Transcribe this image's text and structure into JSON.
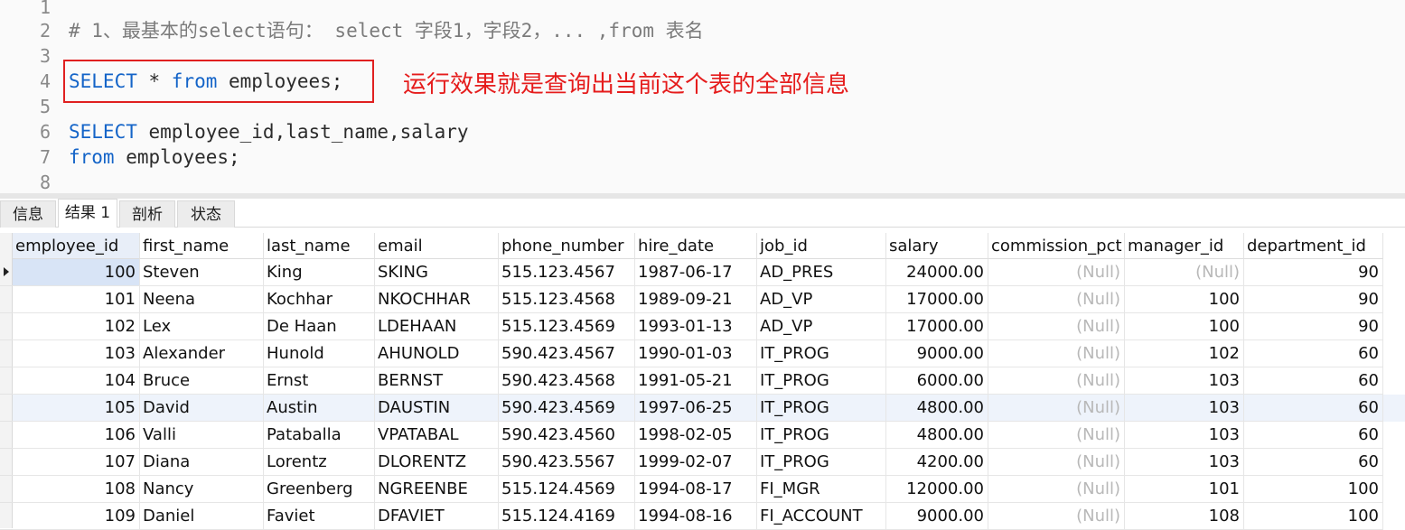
{
  "editor": {
    "lines": [
      {
        "n": "1",
        "parts": []
      },
      {
        "n": "2",
        "parts": [
          {
            "t": "# 1、最基本的select语句： select 字段1，字段2，... ,from 表名",
            "c": "cm"
          }
        ]
      },
      {
        "n": "3",
        "parts": []
      },
      {
        "n": "4",
        "parts": [
          {
            "t": "SELECT",
            "c": "kw"
          },
          {
            "t": " * ",
            "c": "tx"
          },
          {
            "t": "from",
            "c": "kw"
          },
          {
            "t": " employees;",
            "c": "tx"
          }
        ]
      },
      {
        "n": "5",
        "parts": []
      },
      {
        "n": "6",
        "parts": [
          {
            "t": "SELECT",
            "c": "kw"
          },
          {
            "t": " employee_id,last_name,salary",
            "c": "tx"
          }
        ]
      },
      {
        "n": "7",
        "parts": [
          {
            "t": "from",
            "c": "kw"
          },
          {
            "t": " employees;",
            "c": "tx"
          }
        ]
      },
      {
        "n": "8",
        "parts": []
      }
    ],
    "annotation": "运行效果就是查询出当前这个表的全部信息",
    "annotation_color": "#e51c1c",
    "keyword_color": "#1464c8"
  },
  "tabs": [
    {
      "label": "信息",
      "active": false
    },
    {
      "label": "结果 1",
      "active": true
    },
    {
      "label": "剖析",
      "active": false
    },
    {
      "label": "状态",
      "active": false
    }
  ],
  "grid": {
    "columns": [
      "employee_id",
      "first_name",
      "last_name",
      "email",
      "phone_number",
      "hire_date",
      "job_id",
      "salary",
      "commission_pct",
      "manager_id",
      "department_id"
    ],
    "rows": [
      [
        "100",
        "Steven",
        "King",
        "SKING",
        "515.123.4567",
        "1987-06-17",
        "AD_PRES",
        "24000.00",
        "(Null)",
        "(Null)",
        "90"
      ],
      [
        "101",
        "Neena",
        "Kochhar",
        "NKOCHHAR",
        "515.123.4568",
        "1989-09-21",
        "AD_VP",
        "17000.00",
        "(Null)",
        "100",
        "90"
      ],
      [
        "102",
        "Lex",
        "De Haan",
        "LDEHAAN",
        "515.123.4569",
        "1993-01-13",
        "AD_VP",
        "17000.00",
        "(Null)",
        "100",
        "90"
      ],
      [
        "103",
        "Alexander",
        "Hunold",
        "AHUNOLD",
        "590.423.4567",
        "1990-01-03",
        "IT_PROG",
        "9000.00",
        "(Null)",
        "102",
        "60"
      ],
      [
        "104",
        "Bruce",
        "Ernst",
        "BERNST",
        "590.423.4568",
        "1991-05-21",
        "IT_PROG",
        "6000.00",
        "(Null)",
        "103",
        "60"
      ],
      [
        "105",
        "David",
        "Austin",
        "DAUSTIN",
        "590.423.4569",
        "1997-06-25",
        "IT_PROG",
        "4800.00",
        "(Null)",
        "103",
        "60"
      ],
      [
        "106",
        "Valli",
        "Pataballa",
        "VPATABAL",
        "590.423.4560",
        "1998-02-05",
        "IT_PROG",
        "4800.00",
        "(Null)",
        "103",
        "60"
      ],
      [
        "107",
        "Diana",
        "Lorentz",
        "DLORENTZ",
        "590.423.5567",
        "1999-02-07",
        "IT_PROG",
        "4200.00",
        "(Null)",
        "103",
        "60"
      ],
      [
        "108",
        "Nancy",
        "Greenberg",
        "NGREENBE",
        "515.124.4569",
        "1994-08-17",
        "FI_MGR",
        "12000.00",
        "(Null)",
        "101",
        "100"
      ],
      [
        "109",
        "Daniel",
        "Faviet",
        "DFAVIET",
        "515.124.4169",
        "1994-08-16",
        "FI_ACCOUNT",
        "9000.00",
        "(Null)",
        "108",
        "100"
      ]
    ],
    "null_text": "(Null)",
    "highlight_row": 5
  }
}
